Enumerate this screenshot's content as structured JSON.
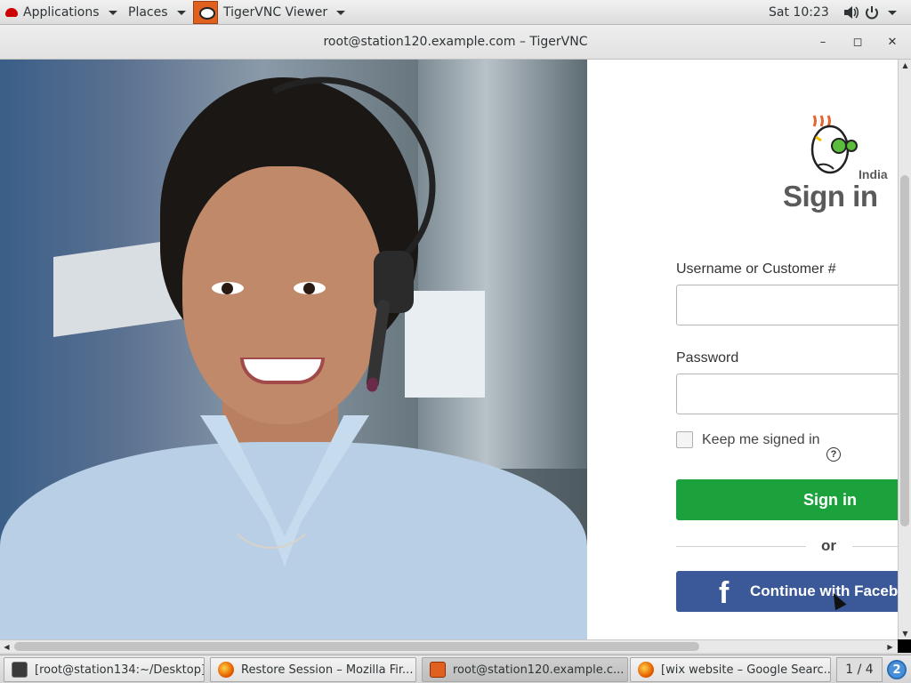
{
  "topbar": {
    "applications_label": "Applications",
    "places_label": "Places",
    "active_app_label": "TigerVNC Viewer",
    "clock": "Sat 10:23"
  },
  "window": {
    "title": "root@station120.example.com – TigerVNC",
    "minimize_glyph": "–",
    "maximize_glyph": "◻",
    "close_glyph": "✕"
  },
  "signin_page": {
    "region_label": "India",
    "title": "Sign in",
    "username_label": "Username or Customer #",
    "username_value": "",
    "password_label": "Password",
    "password_value": "",
    "keep_signed_in_label": "Keep me signed in",
    "keep_signed_in_checked": false,
    "help_glyph": "?",
    "signin_button_label": "Sign in",
    "or_label": "or",
    "facebook_glyph": "f",
    "facebook_button_label": "Continue with Facebook",
    "colors": {
      "signin_green": "#1ba23c",
      "facebook_blue": "#3b5998"
    }
  },
  "taskbar": {
    "items": [
      {
        "label": "[root@station134:~/Desktop]",
        "icon": "terminal-icon",
        "active": false
      },
      {
        "label": "Restore Session – Mozilla Fir...",
        "icon": "firefox-icon",
        "active": false
      },
      {
        "label": "root@station120.example.c...",
        "icon": "tigervnc-icon",
        "active": true
      },
      {
        "label": "[wix website – Google Searc...",
        "icon": "firefox-icon",
        "active": false
      }
    ],
    "workspace_indicator": "1 / 4",
    "notification_count": "2"
  }
}
